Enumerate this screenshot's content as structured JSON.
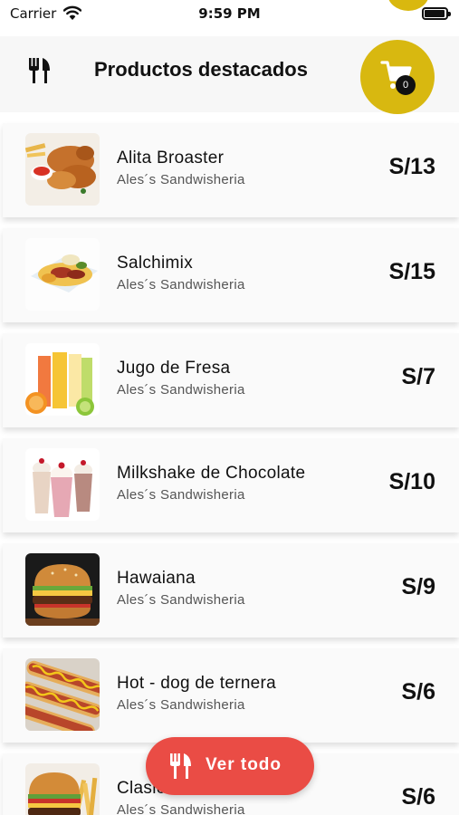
{
  "status_bar": {
    "carrier": "Carrier",
    "time": "9:59 PM"
  },
  "header": {
    "title": "Productos destacados",
    "menu_icon": "utensils-icon",
    "cart_icon": "shopping-cart-icon",
    "cart_count": "0"
  },
  "products": [
    {
      "name": "Alita Broaster",
      "store": "Ales´s Sandwisheria",
      "price": "S/13",
      "image": "fried-chicken"
    },
    {
      "name": "Salchimix",
      "store": "Ales´s Sandwisheria",
      "price": "S/15",
      "image": "sausage-fries"
    },
    {
      "name": "Jugo de Fresa",
      "store": "Ales´s Sandwisheria",
      "price": "S/7",
      "image": "juice-glasses"
    },
    {
      "name": "Milkshake de Chocolate",
      "store": "Ales´s Sandwisheria",
      "price": "S/10",
      "image": "milkshakes"
    },
    {
      "name": "Hawaiana",
      "store": "Ales´s Sandwisheria",
      "price": "S/9",
      "image": "burger"
    },
    {
      "name": "Hot - dog de ternera",
      "store": "Ales´s Sandwisheria",
      "price": "S/6",
      "image": "hot-dogs"
    },
    {
      "name": "Clasica",
      "store": "Ales´s Sandwisheria",
      "price": "S/6",
      "image": "burger-fries"
    }
  ],
  "see_all_button": {
    "label": "Ver todo",
    "icon": "utensils-icon"
  },
  "colors": {
    "accent_yellow": "#d8b810",
    "button_red": "#ea4c45",
    "badge_black": "#111111"
  }
}
